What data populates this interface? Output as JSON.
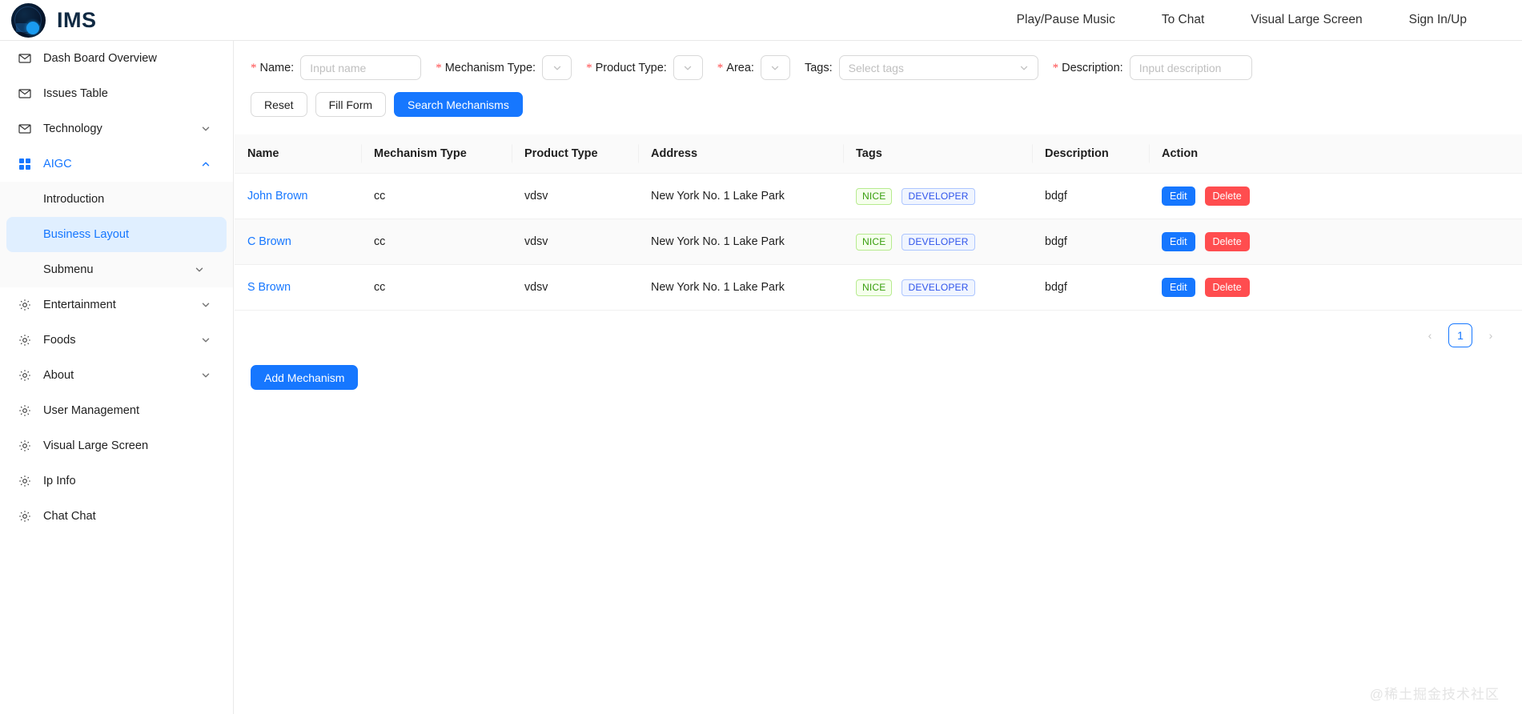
{
  "header": {
    "brand": "IMS",
    "logo_icon": "ims-globe-logo",
    "nav": [
      {
        "label": "Play/Pause Music",
        "name": "nav-play-pause-music"
      },
      {
        "label": "To Chat",
        "name": "nav-to-chat"
      },
      {
        "label": "Visual Large Screen",
        "name": "nav-visual-large-screen"
      },
      {
        "label": "Sign In/Up",
        "name": "nav-sign-in-up"
      }
    ]
  },
  "sidebar": {
    "items": [
      {
        "label": "Dash Board Overview",
        "icon": "mail-icon",
        "expandable": false,
        "active": false
      },
      {
        "label": "Issues Table",
        "icon": "mail-icon",
        "expandable": false,
        "active": false
      },
      {
        "label": "Technology",
        "icon": "mail-icon",
        "expandable": true,
        "expanded": false,
        "active": false
      },
      {
        "label": "AIGC",
        "icon": "appstore-grid-icon",
        "expandable": true,
        "expanded": true,
        "active": true
      }
    ],
    "aigc_submenu": [
      {
        "label": "Introduction",
        "selected": false,
        "expandable": false
      },
      {
        "label": "Business Layout",
        "selected": true,
        "expandable": false
      },
      {
        "label": "Submenu",
        "selected": false,
        "expandable": true
      }
    ],
    "items_after": [
      {
        "label": "Entertainment",
        "icon": "gear-icon",
        "expandable": true
      },
      {
        "label": "Foods",
        "icon": "gear-icon",
        "expandable": true
      },
      {
        "label": "About",
        "icon": "gear-icon",
        "expandable": true
      },
      {
        "label": "User Management",
        "icon": "gear-icon",
        "expandable": false
      },
      {
        "label": "Visual Large Screen",
        "icon": "gear-icon",
        "expandable": false
      },
      {
        "label": "Ip Info",
        "icon": "gear-icon",
        "expandable": false
      },
      {
        "label": "Chat Chat",
        "icon": "gear-icon",
        "expandable": false
      }
    ]
  },
  "search_form": {
    "name": {
      "label": "Name:",
      "required": true,
      "value": "",
      "placeholder": "Input name"
    },
    "mechanism_type": {
      "label": "Mechanism Type:",
      "required": true,
      "value": ""
    },
    "product_type": {
      "label": "Product Type:",
      "required": true,
      "value": ""
    },
    "area": {
      "label": "Area:",
      "required": true,
      "value": ""
    },
    "tags": {
      "label": "Tags:",
      "required": false,
      "value": "",
      "placeholder": "Select tags"
    },
    "description": {
      "label": "Description:",
      "required": true,
      "value": "",
      "placeholder": "Input description"
    },
    "buttons": {
      "reset": "Reset",
      "fill_form": "Fill Form",
      "search": "Search Mechanisms"
    }
  },
  "table": {
    "columns": [
      "Name",
      "Mechanism Type",
      "Product Type",
      "Address",
      "Tags",
      "Description",
      "Action"
    ],
    "rows": [
      {
        "name": "John Brown",
        "mechanism_type": "cc",
        "product_type": "vdsv",
        "address": "New York No. 1 Lake Park",
        "tags": [
          {
            "label": "NICE",
            "color": "green"
          },
          {
            "label": "DEVELOPER",
            "color": "blue"
          }
        ],
        "description": "bdgf",
        "actions": {
          "edit": "Edit",
          "delete": "Delete"
        }
      },
      {
        "name": "C Brown",
        "mechanism_type": "cc",
        "product_type": "vdsv",
        "address": "New York No. 1 Lake Park",
        "tags": [
          {
            "label": "NICE",
            "color": "green"
          },
          {
            "label": "DEVELOPER",
            "color": "blue"
          }
        ],
        "description": "bdgf",
        "actions": {
          "edit": "Edit",
          "delete": "Delete"
        }
      },
      {
        "name": "S Brown",
        "mechanism_type": "cc",
        "product_type": "vdsv",
        "address": "New York No. 1 Lake Park",
        "tags": [
          {
            "label": "NICE",
            "color": "green"
          },
          {
            "label": "DEVELOPER",
            "color": "blue"
          }
        ],
        "description": "bdgf",
        "actions": {
          "edit": "Edit",
          "delete": "Delete"
        }
      }
    ]
  },
  "pagination": {
    "prev": "‹",
    "current_page": "1",
    "next": "›"
  },
  "footer_actions": {
    "add_mechanism": "Add Mechanism"
  },
  "watermark": "@稀土掘金技术社区",
  "colors": {
    "primary": "#1677ff",
    "danger": "#ff4d4f",
    "required_star": "#ff4d4f",
    "tag_green_text": "#389e0d",
    "tag_green_border": "#b7eb8f",
    "tag_blue_text": "#2f54eb",
    "tag_blue_border": "#adc6ff",
    "selected_menu_bg": "#e0efff",
    "submenu_bg": "#fafafa",
    "table_header_bg": "#fafafa"
  }
}
